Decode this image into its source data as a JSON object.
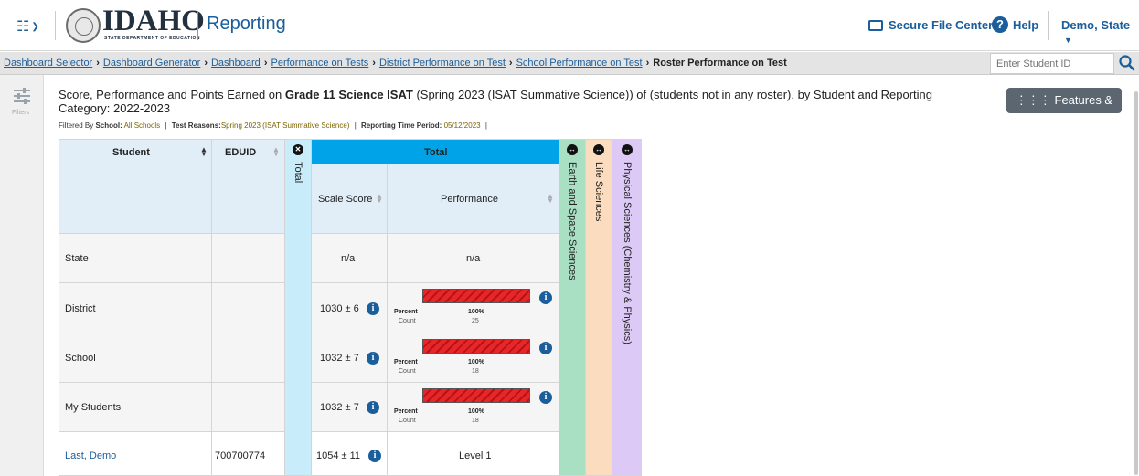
{
  "header": {
    "app_title": "Reporting",
    "logo_text": "IDAHO",
    "logo_subtext": "STATE DEPARTMENT OF EDUCATION",
    "secure_file": "Secure File Center",
    "help": "Help",
    "user": "Demo, State"
  },
  "breadcrumb": {
    "items": [
      "Dashboard Selector",
      "Dashboard Generator",
      "Dashboard",
      "Performance on Tests",
      "District Performance on Test",
      "School Performance on Test"
    ],
    "current": "Roster Performance on Test",
    "sep": "›"
  },
  "search": {
    "placeholder": "Enter Student ID"
  },
  "sidebar": {
    "filters_label": "Filters"
  },
  "report": {
    "title_prefix": "Score, Performance and Points Earned on ",
    "title_bold": "Grade 11 Science ISAT",
    "title_suffix": " (Spring 2023 (ISAT Summative Science)) of (students not in any roster), by Student and Reporting Category: 2022-2023",
    "filtered_by": "Filtered By",
    "school_label": "School:",
    "school_value": "All Schools",
    "reasons_label": "Test Reasons:",
    "reasons_value": "Spring 2023 (ISAT Summative Science)",
    "period_label": "Reporting Time Period:",
    "period_value": "05/12/2023",
    "pipe": "|",
    "features_button": "Features & Tools"
  },
  "table": {
    "col_student": "Student",
    "col_eduid": "EDUID",
    "col_total_collapsed": "Total",
    "col_total_group": "Total",
    "col_scale_score": "Scale Score",
    "col_performance": "Performance",
    "col_earth": "Earth and Space Sciences",
    "col_life": "Life Sciences",
    "col_physical": "Physical Sciences (Chemistry & Physics)",
    "percent_label": "Percent",
    "count_label": "Count",
    "rows": [
      {
        "student": "State",
        "eduid": "",
        "scale": "n/a",
        "perf_text": "n/a"
      },
      {
        "student": "District",
        "eduid": "",
        "scale": "1030 ± 6",
        "percent": "100%",
        "count": "25"
      },
      {
        "student": "School",
        "eduid": "",
        "scale": "1032 ± 7",
        "percent": "100%",
        "count": "18"
      },
      {
        "student": "My Students",
        "eduid": "",
        "scale": "1032 ± 7",
        "percent": "100%",
        "count": "18"
      },
      {
        "student": "Last, Demo",
        "eduid": "700700774",
        "scale": "1054 ± 11",
        "perf_text": "Level 1"
      }
    ]
  },
  "colors": {
    "header_bg": "#e2eef7",
    "total_group": "#00a3e8",
    "total_strip": "#c9ecfb",
    "earth": "#a9e0c3",
    "life": "#fbdcbe",
    "physical": "#ddc9f5",
    "bar": "#e8262a"
  }
}
